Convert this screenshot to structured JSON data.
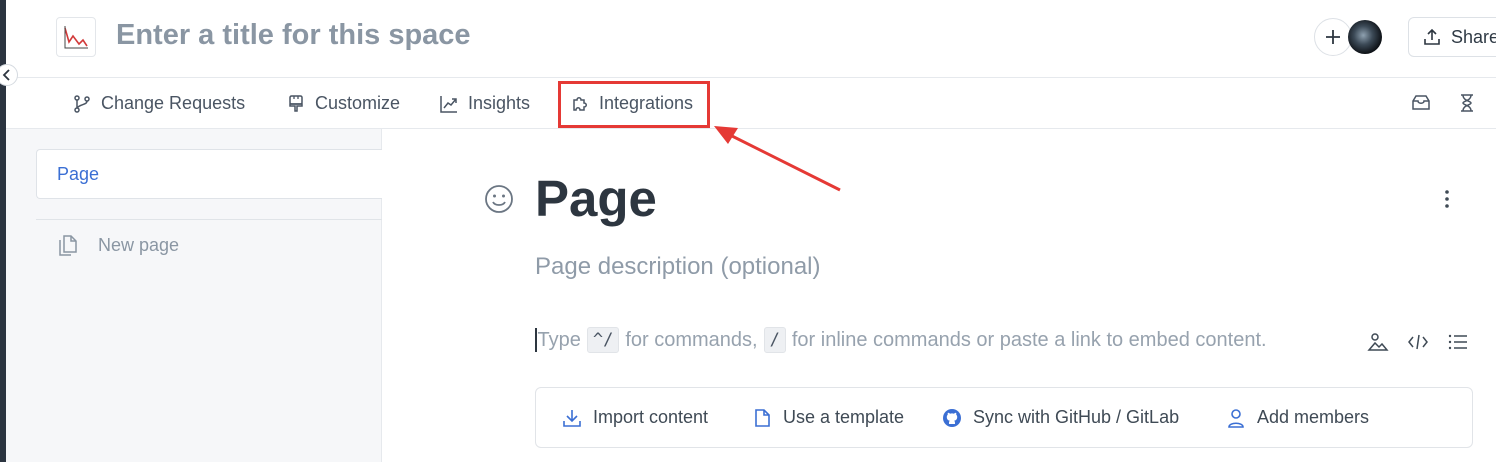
{
  "header": {
    "title_placeholder": "Enter a title for this space",
    "share_label": "Share",
    "icons": [
      "logo-chart-icon",
      "plus-icon",
      "avatar",
      "share-upload-icon"
    ]
  },
  "subnav": {
    "items": [
      {
        "label": "Change Requests",
        "icon": "branch-icon"
      },
      {
        "label": "Customize",
        "icon": "paint-brush-icon"
      },
      {
        "label": "Insights",
        "icon": "trend-chart-icon"
      },
      {
        "label": "Integrations",
        "icon": "puzzle-icon"
      }
    ],
    "right_icons": [
      "inbox-icon",
      "hourglass-icon"
    ],
    "highlight_color": "#e53935"
  },
  "sidebar": {
    "page_label": "Page",
    "new_page_label": "New page"
  },
  "main": {
    "page_title": "Page",
    "description_placeholder": "Page description (optional)",
    "editor_hint": {
      "part1": "Type",
      "kbd1": "^/",
      "part2": "for commands,",
      "kbd2": "/",
      "part3": "for inline commands or paste a link to embed content."
    },
    "actions": [
      {
        "label": "Import content",
        "icon": "download-icon"
      },
      {
        "label": "Use a template",
        "icon": "file-icon"
      },
      {
        "label": "Sync with GitHub / GitLab",
        "icon": "github-icon"
      },
      {
        "label": "Add members",
        "icon": "user-icon"
      }
    ]
  },
  "colors": {
    "accent": "#3b6fd4",
    "annotation": "#e53935"
  }
}
